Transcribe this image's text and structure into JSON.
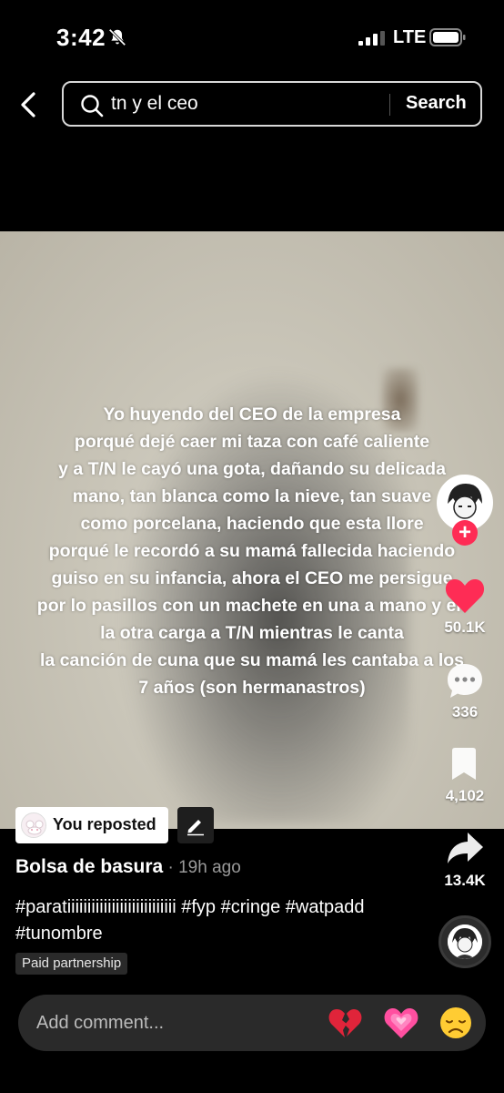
{
  "status_bar": {
    "time": "3:42",
    "network": "LTE"
  },
  "search": {
    "query": "tn y el ceo",
    "button_label": "Search"
  },
  "video": {
    "caption_lines": [
      "Yo huyendo del CEO de la empresa",
      "porqué dejé caer mi taza con café caliente",
      "y a T/N le cayó una gota, dañando su delicada",
      "mano, tan blanca como la nieve, tan suave",
      "como porcelana, haciendo que esta llore",
      "porqué le recordó a su mamá fallecida haciendo",
      "guiso en su infancia, ahora el  CEO me persigue",
      "por lo pasillos con un machete en una a mano y en",
      "la otra carga a T/N mientras le canta",
      "la canción de cuna que su mamá les  cantaba a los",
      "7 años (son hermanastros)"
    ]
  },
  "actions": {
    "follow_symbol": "+",
    "likes": "50.1K",
    "comments": "336",
    "bookmarks": "4,102",
    "shares": "13.4K"
  },
  "post": {
    "repost_label": "You reposted",
    "author": "Bolsa de basura",
    "time": " · 19h ago",
    "description": "#paratiiiiiiiiiiiiiiiiiiiiiiiiiii #fyp #cringe #watpadd #tunombre",
    "paid_label": "Paid partnership"
  },
  "comment_bar": {
    "placeholder": "Add comment...",
    "emojis": [
      "broken-heart-icon",
      "growing-heart-icon",
      "disappointed-face-icon"
    ]
  },
  "colors": {
    "like": "#fe2c55",
    "background": "#000000",
    "comment_bar": "#2a2a2a"
  }
}
